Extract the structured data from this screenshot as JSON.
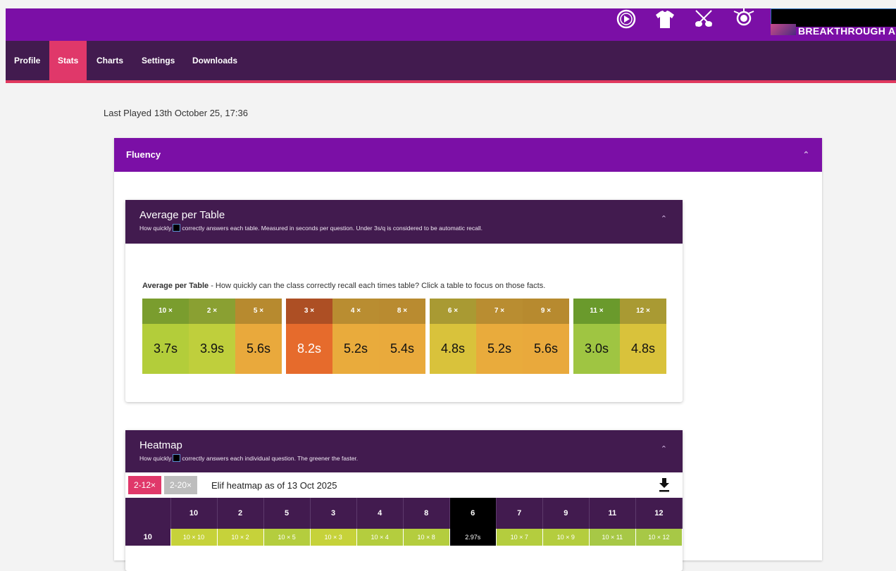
{
  "top_icons": [
    {
      "name": "play-circle-icon"
    },
    {
      "name": "tshirt-icon"
    },
    {
      "name": "guitars-icon"
    },
    {
      "name": "drum-kit-icon"
    }
  ],
  "brand": {
    "text": "BREAKTHROUGH ARTS"
  },
  "nav": {
    "items": [
      {
        "label": "Profile",
        "active": false
      },
      {
        "label": "Stats",
        "active": true
      },
      {
        "label": "Charts",
        "active": false
      },
      {
        "label": "Settings",
        "active": false
      },
      {
        "label": "Downloads",
        "active": false
      }
    ]
  },
  "last_played": {
    "label": "Last Played",
    "value": "13th October 25, 17:36"
  },
  "fluency": {
    "title": "Fluency",
    "avg": {
      "title": "Average per Table",
      "sub_before": "How quickly",
      "sub_after": "correctly answers each table. Measured in seconds per question. Under 3s/q is considered to be automatic recall.",
      "caption_bold": "Average per Table",
      "caption_rest": " - How quickly can the class correctly recall each times table? Click a table to focus on those facts.",
      "groups": [
        [
          {
            "table": "10 ×",
            "value": "3.7s",
            "head": "#7a9d2e",
            "bg": "#b3cd3a"
          },
          {
            "table": "2 ×",
            "value": "3.9s",
            "head": "#8aa032",
            "bg": "#bfcf3c"
          },
          {
            "table": "5 ×",
            "value": "5.6s",
            "head": "#b78a2f",
            "bg": "#e9a93c"
          }
        ],
        [
          {
            "table": "3 ×",
            "value": "8.2s",
            "head": "#ad4f24",
            "bg": "#e66b2c",
            "dark": true
          },
          {
            "table": "4 ×",
            "value": "5.2s",
            "head": "#b98d31",
            "bg": "#e9ab3c"
          },
          {
            "table": "8 ×",
            "value": "5.4s",
            "head": "#b98b30",
            "bg": "#e9aa3c"
          }
        ],
        [
          {
            "table": "6 ×",
            "value": "4.8s",
            "head": "#a99a33",
            "bg": "#d9c23b"
          },
          {
            "table": "7 ×",
            "value": "5.2s",
            "head": "#b98d31",
            "bg": "#e9ab3c"
          },
          {
            "table": "9 ×",
            "value": "5.6s",
            "head": "#b78a2f",
            "bg": "#e9a93c"
          }
        ],
        [
          {
            "table": "11 ×",
            "value": "3.0s",
            "head": "#6a9a2c",
            "bg": "#9fc542"
          },
          {
            "table": "12 ×",
            "value": "4.8s",
            "head": "#a99a33",
            "bg": "#d9c23b"
          }
        ]
      ]
    },
    "heatmap": {
      "title": "Heatmap",
      "sub_before": "How quickly",
      "sub_after": "correctly answers each individual question. The greener the faster.",
      "range_active": "2-12×",
      "range_inactive": "2-20×",
      "heading": "Elif heatmap as of 13 Oct 2025",
      "columns": [
        "10",
        "2",
        "5",
        "3",
        "4",
        "8",
        "6",
        "7",
        "9",
        "11",
        "12"
      ],
      "black_column": "6",
      "rows": [
        {
          "label": "10",
          "cells": [
            {
              "text": "10 × 10",
              "color": "#c6d23a"
            },
            {
              "text": "10 × 2",
              "color": "#c6d23a"
            },
            {
              "text": "10 × 5",
              "color": "#b4cd3e"
            },
            {
              "text": "10 × 3",
              "color": "#c6d23a"
            },
            {
              "text": "10 × 4",
              "color": "#b4cd3e"
            },
            {
              "text": "10 × 8",
              "color": "#b4cd3e"
            },
            {
              "text": "2.97s",
              "color": "#000000"
            },
            {
              "text": "10 × 7",
              "color": "#b4cd3e"
            },
            {
              "text": "10 × 9",
              "color": "#b4cd3e"
            },
            {
              "text": "10 × 11",
              "color": "#a7c846"
            },
            {
              "text": "10 × 12",
              "color": "#a7c846"
            }
          ]
        }
      ]
    }
  }
}
